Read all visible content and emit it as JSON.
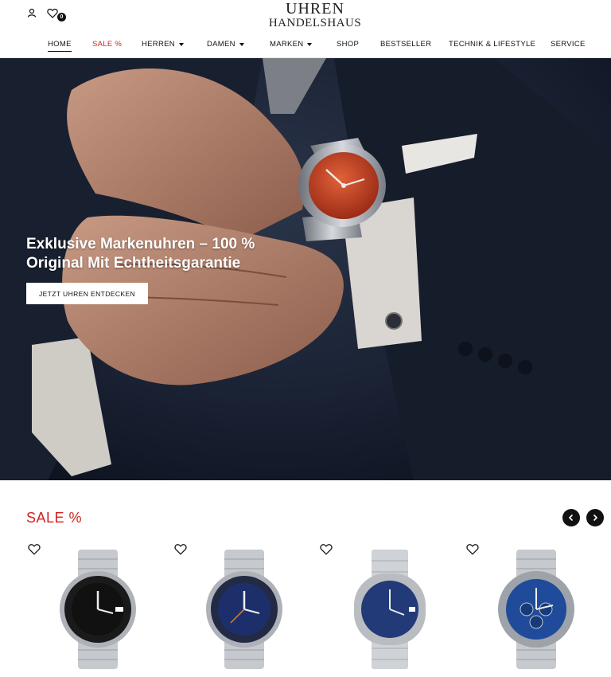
{
  "header": {
    "logo_line1": "UHREN",
    "logo_line2": "HANDELSHAUS",
    "wishlist_count": "0",
    "icons": [
      "user-icon",
      "heart-icon"
    ]
  },
  "nav": {
    "items": [
      {
        "label": "HOME",
        "active": true
      },
      {
        "label": "SALE %",
        "highlight": "#d0231c"
      },
      {
        "label": "HERREN",
        "dropdown": true
      },
      {
        "label": "DAMEN",
        "dropdown": true
      },
      {
        "label": "MARKEN",
        "dropdown": true
      },
      {
        "label": "SHOP"
      },
      {
        "label": "BESTSELLER"
      },
      {
        "label": "TECHNIK & LIFESTYLE"
      },
      {
        "label": "SERVICE"
      }
    ]
  },
  "hero": {
    "title": "Exklusive Markenuhren – 100 % Original Mit Echtheitsgarantie",
    "cta_label": "JETZT UHREN ENTDECKEN"
  },
  "sale": {
    "title": "SALE %",
    "accent_color": "#d0231c",
    "products": [
      {
        "dial": "#111111",
        "bezel": "#1a1a1a"
      },
      {
        "dial": "#1d2f6b",
        "bezel": "#222a44"
      },
      {
        "dial": "#233a78",
        "bezel": "#b9bcc1"
      },
      {
        "dial": "#1f4b9a",
        "bezel": "#9ea3aa"
      }
    ]
  }
}
